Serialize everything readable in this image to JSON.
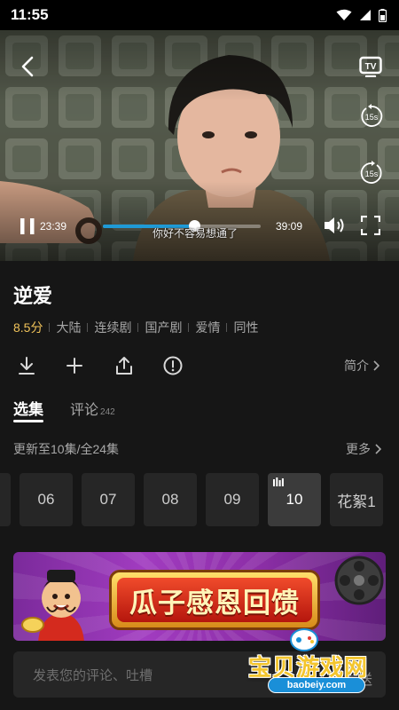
{
  "status_bar": {
    "time": "11:55"
  },
  "player": {
    "current_time": "23:39",
    "total_time": "39:09",
    "progress": 0.58,
    "subtitle": "你好不容易想通了",
    "skip_back_label": "15s",
    "skip_forward_label": "15s",
    "tv_label": "TV"
  },
  "show": {
    "title": "逆爱",
    "score": "8.5分",
    "tags": [
      "大陆",
      "连续剧",
      "国产剧",
      "爱情",
      "同性"
    ],
    "intro_label": "简介"
  },
  "tabs": {
    "episodes_label": "选集",
    "comments_label": "评论",
    "comments_count": "242"
  },
  "episodes": {
    "update_text": "更新至10集/全24集",
    "more_label": "更多",
    "items": [
      "06",
      "07",
      "08",
      "09",
      "10",
      "花絮1"
    ],
    "active_index": 4
  },
  "banner": {
    "text": "瓜子感恩回馈"
  },
  "comment": {
    "placeholder": "发表您的评论、吐槽",
    "send_label": "发送"
  },
  "watermark": {
    "text": "宝贝游戏网",
    "url": "baobeiy.com"
  },
  "colors": {
    "accent": "#1f9ad6",
    "score": "#f0c35a",
    "background": "#161616"
  }
}
